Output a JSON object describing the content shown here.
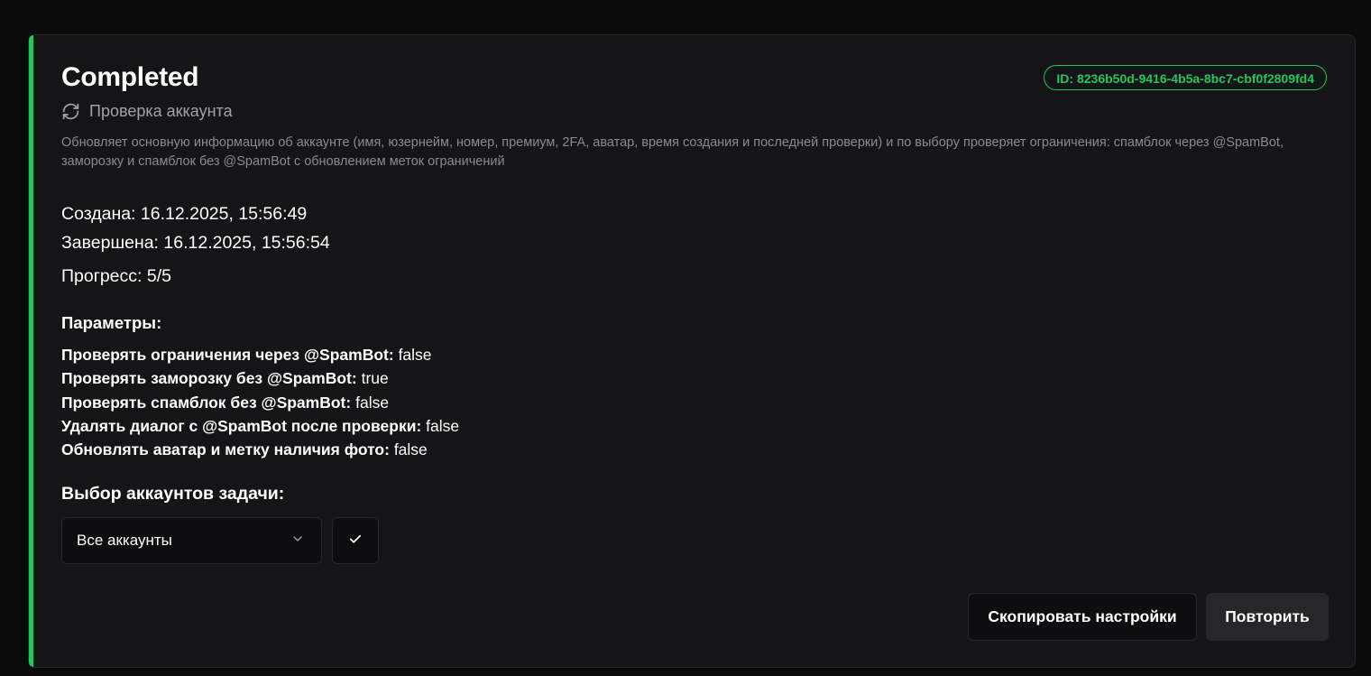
{
  "task": {
    "status": "Completed",
    "id_label": "ID: 8236b50d-9416-4b5a-8bc7-cbf0f2809fd4",
    "type_label": "Проверка аккаунта",
    "description": "Обновляет основную информацию об аккаунте (имя, юзернейм, номер, премиум, 2FA, аватар, время создания и последней проверки) и по выбору проверяет ограничения: спамблок через @SpamBot, заморозку и спамблок без @SpamBot с обновлением меток ограничений",
    "created": "Создана: 16.12.2025, 15:56:49",
    "finished": "Завершена: 16.12.2025, 15:56:54",
    "progress": "Прогресс: 5/5"
  },
  "params": {
    "title": "Параметры:",
    "items": [
      {
        "key": "Проверять ограничения через @SpamBot:",
        "value": "false"
      },
      {
        "key": "Проверять заморозку без @SpamBot:",
        "value": "true"
      },
      {
        "key": "Проверять спамблок без @SpamBot:",
        "value": "false"
      },
      {
        "key": "Удалять диалог с @SpamBot после проверки:",
        "value": "false"
      },
      {
        "key": "Обновлять аватар и метку наличия фото:",
        "value": "false"
      }
    ]
  },
  "account_select": {
    "title": "Выбор аккаунтов задачи:",
    "selected": "Все аккаунты"
  },
  "actions": {
    "copy_label": "Скопировать настройки",
    "repeat_label": "Повторить"
  },
  "icons": {
    "task_type": "refresh-icon",
    "dropdown": "chevron-down-icon",
    "confirm": "check-icon"
  },
  "colors": {
    "accent": "#22c55e",
    "background": "#0b0b0c",
    "card": "#151518",
    "muted_text": "#8a8a92"
  }
}
